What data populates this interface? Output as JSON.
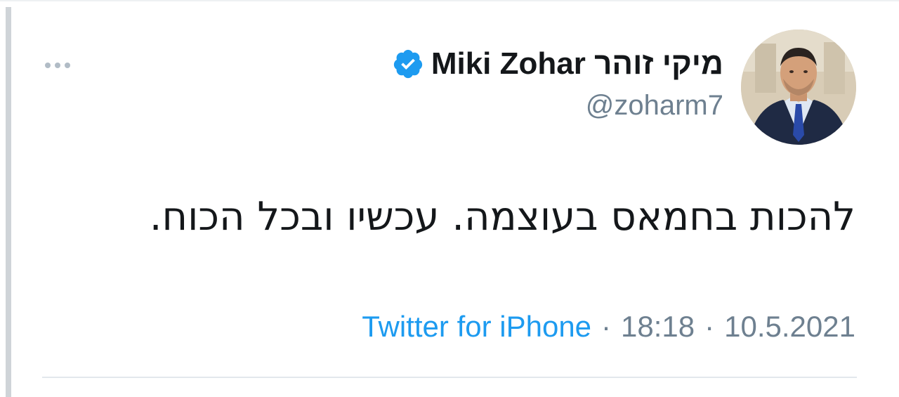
{
  "tweet": {
    "author_name": "Miki Zohar מיקי זוהר",
    "handle": "@zoharm7",
    "verified_icon": "verified-badge-icon",
    "text": "להכות בחמאס בעוצמה. עכשיו ובכל הכוח.",
    "source": "Twitter for iPhone",
    "separator": "·",
    "time": "18:18",
    "date": "10.5.2021",
    "more_icon": "more-options-icon"
  },
  "colors": {
    "text_primary": "#14171a",
    "text_secondary": "#6e8090",
    "link": "#1d9bf0",
    "verified": "#1d9bf0"
  }
}
